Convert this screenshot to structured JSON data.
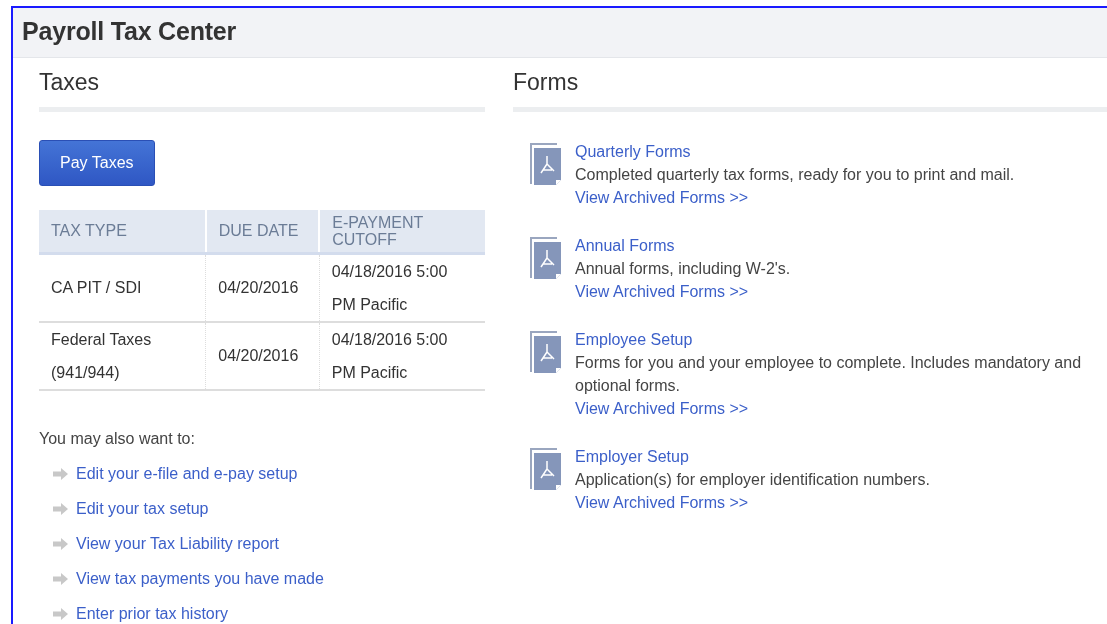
{
  "window": {
    "title": "Payroll Tax Center"
  },
  "taxes": {
    "heading": "Taxes",
    "pay_button": "Pay Taxes",
    "table": {
      "columns": [
        "TAX TYPE",
        "DUE DATE",
        "E-PAYMENT CUTOFF"
      ],
      "rows": [
        [
          "CA PIT / SDI",
          "04/20/2016",
          "04/18/2016 5:00 PM Pacific"
        ],
        [
          "Federal Taxes (941/944)",
          "04/20/2016",
          "04/18/2016 5:00 PM Pacific"
        ]
      ]
    },
    "also_label": "You may also want to:",
    "links": [
      "Edit your e-file and e-pay setup",
      "Edit your tax setup",
      "View your Tax Liability report",
      "View tax payments you have made",
      "Enter prior tax history"
    ]
  },
  "forms": {
    "heading": "Forms",
    "items": [
      {
        "title": "Quarterly Forms",
        "description": "Completed quarterly tax forms, ready for you to print and mail.",
        "link": "View Archived Forms >>"
      },
      {
        "title": "Annual Forms",
        "description": "Annual forms, including W-2's.",
        "link": "View Archived Forms >>"
      },
      {
        "title": "Employee Setup",
        "description": "Forms for you and your employee to complete. Includes mandatory and optional forms.",
        "link": "View Archived Forms >>"
      },
      {
        "title": "Employer Setup",
        "description": "Application(s) for employer identification numbers.",
        "link": "View Archived Forms >>"
      }
    ]
  }
}
